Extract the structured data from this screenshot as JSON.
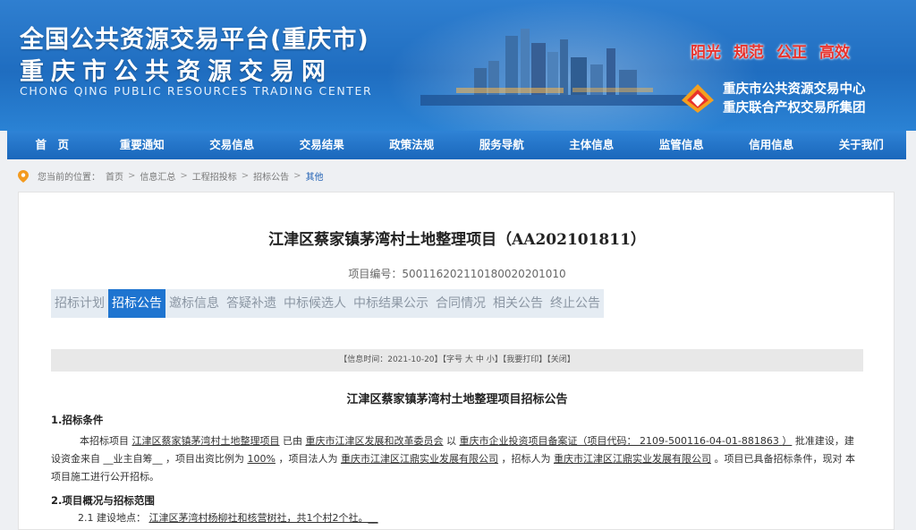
{
  "header": {
    "title_line1": "全国公共资源交易平台(重庆市)",
    "title_line2": "重庆市公共资源交易网",
    "title_en": "CHONG QING PUBLIC RESOURCES TRADING CENTER",
    "slogans": [
      "阳光",
      "规范",
      "公正",
      "高效"
    ],
    "org_line1": "重庆市公共资源交易中心",
    "org_line2": "重庆联合产权交易所集团"
  },
  "nav": [
    "首　页",
    "重要通知",
    "交易信息",
    "交易结果",
    "政策法规",
    "服务导航",
    "主体信息",
    "监管信息",
    "信用信息",
    "关于我们"
  ],
  "breadcrumb": {
    "prefix": "您当前的位置：",
    "items": [
      "首页",
      "信息汇总",
      "工程招投标",
      "招标公告"
    ],
    "current": "其他",
    "sep": ">"
  },
  "project": {
    "title": "江津区蔡家镇茅湾村土地整理项目（AA202101811）",
    "code_label": "项目编号：",
    "code": "500116202110180020201010"
  },
  "tabs": [
    "招标计划",
    "招标公告",
    "邀标信息",
    "答疑补遗",
    "中标候选人",
    "中标结果公示",
    "合同情况",
    "相关公告",
    "终止公告"
  ],
  "info_bar": {
    "date": "【信息时间：2021-10-20】",
    "font_label": "【字号",
    "sizes": [
      "大",
      "中",
      "小"
    ],
    "font_close": "】",
    "print": "【我要打印】",
    "close": "【关闭】"
  },
  "notice": {
    "title": "江津区蔡家镇茅湾村土地整理项目招标公告",
    "sec1": "1.招标条件",
    "p1_a": "本招标项目",
    "p1_project": "江津区蔡家镇茅湾村土地整理项目",
    "p1_b": "已由",
    "p1_approver": "重庆市江津区发展和改革委员会",
    "p1_c": "以",
    "p1_doc": "重庆市企业投资项目备案证（项目代码：",
    "p1_code": "2109-500116-04-01-881863",
    "p1_doc_end": "）",
    "p1_d": "批准建设，建设资金来自",
    "p1_fund": "__业主自筹__",
    "p1_e": "，项目出资比例为",
    "p1_ratio": "100%",
    "p1_f": "，项目法人为",
    "p1_owner": "重庆市江津区江鼎实业发展有限公司",
    "p1_g": "，招标人为",
    "p1_tenderer": "重庆市江津区江鼎实业发展有限公司",
    "p1_h": "。项目已具备招标条件，现对 本 项目施工进行公开招标。",
    "sec2": "2.项目概况与招标范围",
    "p2_label": "2.1 建设地点：",
    "p2_loc": "江津区茅湾村杨柳社和核营树社，共1个村2个社。__"
  },
  "colors": {
    "banner": "#1f6dc0",
    "nav": "#1a67bb",
    "tab_active": "#1e74d0",
    "slogan": "#e8322c"
  }
}
